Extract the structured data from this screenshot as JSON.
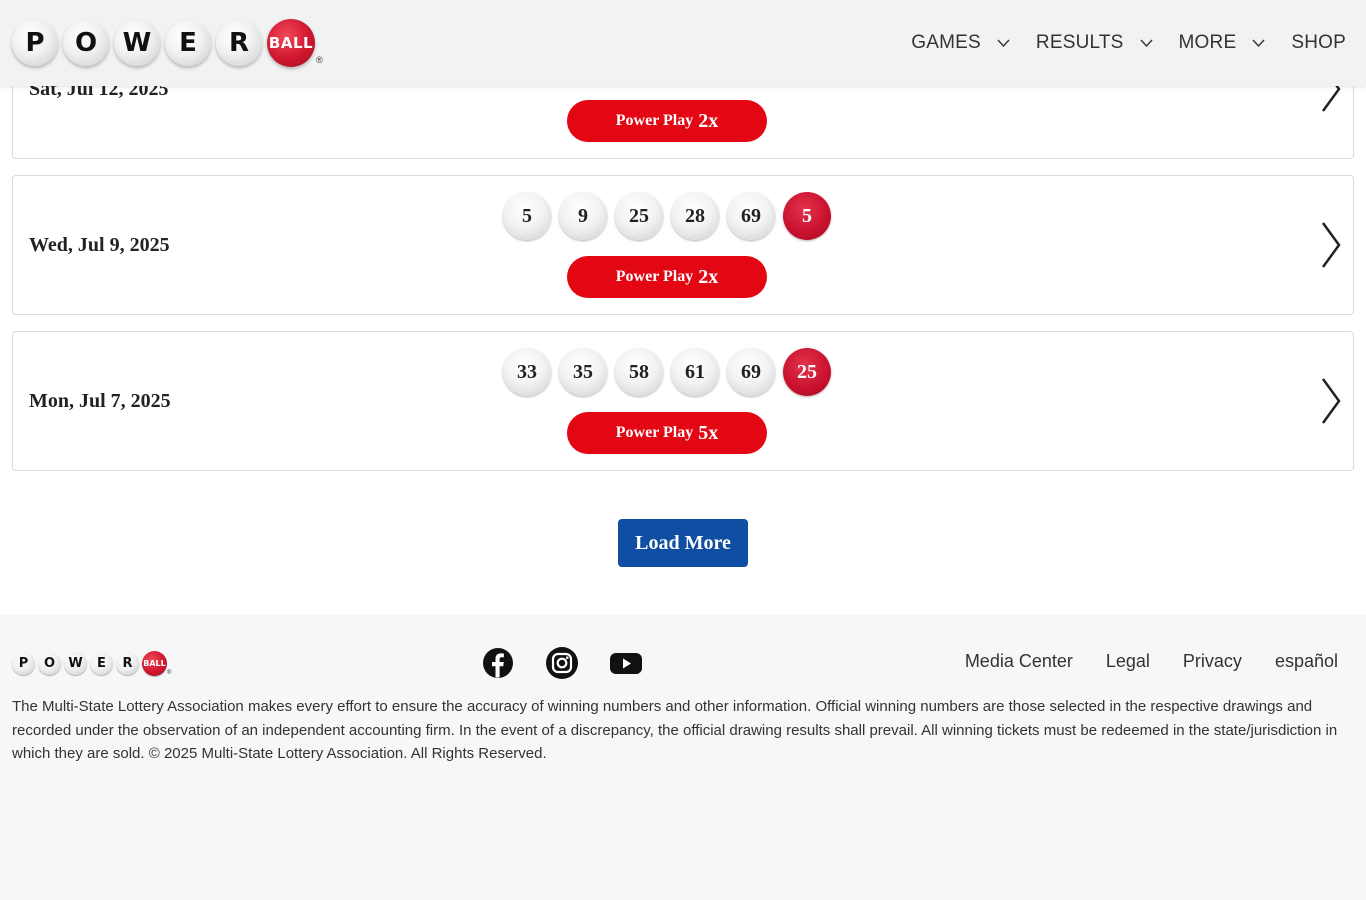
{
  "header": {
    "logo_letters": [
      "P",
      "O",
      "W",
      "E",
      "R"
    ],
    "logo_ball_text": "BALL",
    "logo_reg": "®",
    "nav": [
      {
        "label": "GAMES",
        "has_dropdown": true
      },
      {
        "label": "RESULTS",
        "has_dropdown": true
      },
      {
        "label": "MORE",
        "has_dropdown": true
      },
      {
        "label": "SHOP",
        "has_dropdown": false
      }
    ]
  },
  "results": [
    {
      "date": "Sat, Jul 12, 2025",
      "white_balls": [],
      "powerball": "",
      "power_play_label": "Power Play",
      "power_play": "2x"
    },
    {
      "date": "Wed, Jul 9, 2025",
      "white_balls": [
        "5",
        "9",
        "25",
        "28",
        "69"
      ],
      "powerball": "5",
      "power_play_label": "Power Play",
      "power_play": "2x"
    },
    {
      "date": "Mon, Jul 7, 2025",
      "white_balls": [
        "33",
        "35",
        "58",
        "61",
        "69"
      ],
      "powerball": "25",
      "power_play_label": "Power Play",
      "power_play": "5x"
    }
  ],
  "load_more_label": "Load More",
  "footer": {
    "social": [
      "facebook-icon",
      "instagram-icon",
      "youtube-icon"
    ],
    "links": [
      "Media Center",
      "Legal",
      "Privacy",
      "español"
    ],
    "disclaimer": "The Multi-State Lottery Association makes every effort to ensure the accuracy of winning numbers and other information. Official winning numbers are those selected in the respective drawings and recorded under the observation of an independent accounting firm. In the event of a discrepancy, the official drawing results shall prevail. All winning tickets must be redeemed in the state/jurisdiction in which they are sold. © 2025 Multi-State Lottery Association. All Rights Reserved."
  },
  "colors": {
    "powerball_red": "#c8102e",
    "power_play_red": "#e30613",
    "button_blue": "#0f4ea2"
  }
}
